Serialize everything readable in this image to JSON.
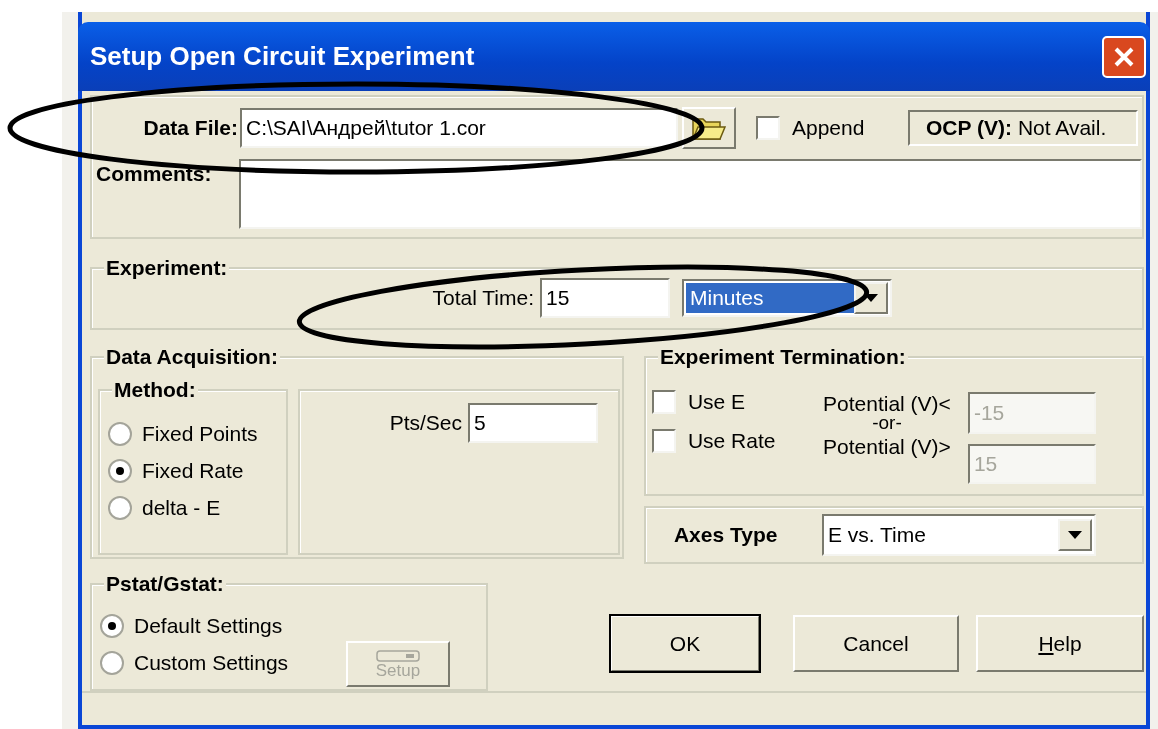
{
  "window": {
    "title": "Setup Open Circuit Experiment"
  },
  "data_file": {
    "label": "Data File:",
    "value": "C:\\SAI\\Андрей\\tutor 1.cor"
  },
  "append": {
    "label": "Append",
    "checked": false
  },
  "ocp": {
    "label": "OCP (V):",
    "value": "Not Avail."
  },
  "comments": {
    "label": "Comments:"
  },
  "experiment": {
    "title": "Experiment:",
    "total_time_label": "Total Time:",
    "total_time": "15",
    "unit": "Minutes"
  },
  "data_acquisition": {
    "title": "Data Acquisition:",
    "method_title": "Method:",
    "methods": [
      {
        "label": "Fixed Points",
        "selected": false
      },
      {
        "label": "Fixed Rate",
        "selected": true
      },
      {
        "label": "delta - E",
        "selected": false
      }
    ],
    "rate_label": "Pts/Sec",
    "rate": "5"
  },
  "termination": {
    "title": "Experiment Termination:",
    "options": [
      {
        "label": "Use E",
        "checked": false
      },
      {
        "label": "Use Rate",
        "checked": false
      }
    ],
    "lower_label": "Potential (V)<",
    "lower": "-15",
    "or_label": "-or-",
    "upper_label": "Potential (V)>",
    "upper": "15",
    "disabled": true
  },
  "axes_type": {
    "label": "Axes Type",
    "value": "E vs. Time"
  },
  "pstat": {
    "title": "Pstat/Gstat:",
    "options": [
      {
        "label": "Default Settings",
        "selected": true
      },
      {
        "label": "Custom Settings",
        "selected": false
      }
    ],
    "setup_button": {
      "label": "Setup",
      "disabled": true
    }
  },
  "buttons": [
    {
      "label": "OK",
      "default": true,
      "underline_first": false
    },
    {
      "label": "Cancel",
      "default": false,
      "underline_first": false
    },
    {
      "label": "Help",
      "default": false,
      "underline_first": true
    }
  ]
}
